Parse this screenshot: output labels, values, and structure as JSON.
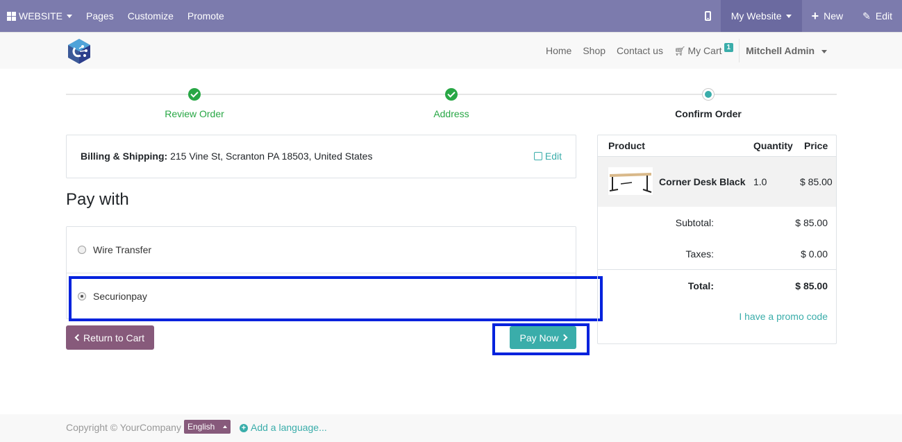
{
  "adminbar": {
    "website_label": "WEBSITE",
    "pages": "Pages",
    "customize": "Customize",
    "promote": "Promote",
    "my_website": "My Website",
    "new": "New",
    "edit": "Edit"
  },
  "header": {
    "nav": [
      "Home",
      "Shop",
      "Contact us"
    ],
    "cart_label": "My Cart",
    "cart_count": "1",
    "user": "Mitchell Admin"
  },
  "wizard": {
    "steps": [
      {
        "label": "Review Order",
        "state": "done"
      },
      {
        "label": "Address",
        "state": "done"
      },
      {
        "label": "Confirm Order",
        "state": "current"
      }
    ]
  },
  "address": {
    "label": "Billing & Shipping:",
    "value": "215 Vine St, Scranton PA 18503, United States",
    "edit": "Edit"
  },
  "payment": {
    "title": "Pay with",
    "options": [
      {
        "label": "Wire Transfer",
        "checked": false
      },
      {
        "label": "Securionpay",
        "checked": true
      }
    ],
    "return_label": "Return to Cart",
    "pay_label": "Pay Now"
  },
  "summary": {
    "headers": {
      "product": "Product",
      "quantity": "Quantity",
      "price": "Price"
    },
    "product": {
      "name": "Corner Desk Black",
      "qty": "1.0",
      "price": "$ 85.00"
    },
    "subtotal_label": "Subtotal:",
    "subtotal": "$ 85.00",
    "taxes_label": "Taxes:",
    "taxes": "$ 0.00",
    "total_label": "Total:",
    "total": "$ 85.00",
    "promo": "I have a promo code"
  },
  "footer": {
    "copyright": "Copyright © YourCompany",
    "language": "English",
    "add_language": "Add a language..."
  },
  "colors": {
    "adminbar": "#7c7bad",
    "accent": "#3aadaa",
    "primary": "#875a7b",
    "highlight": "#0022dd"
  }
}
